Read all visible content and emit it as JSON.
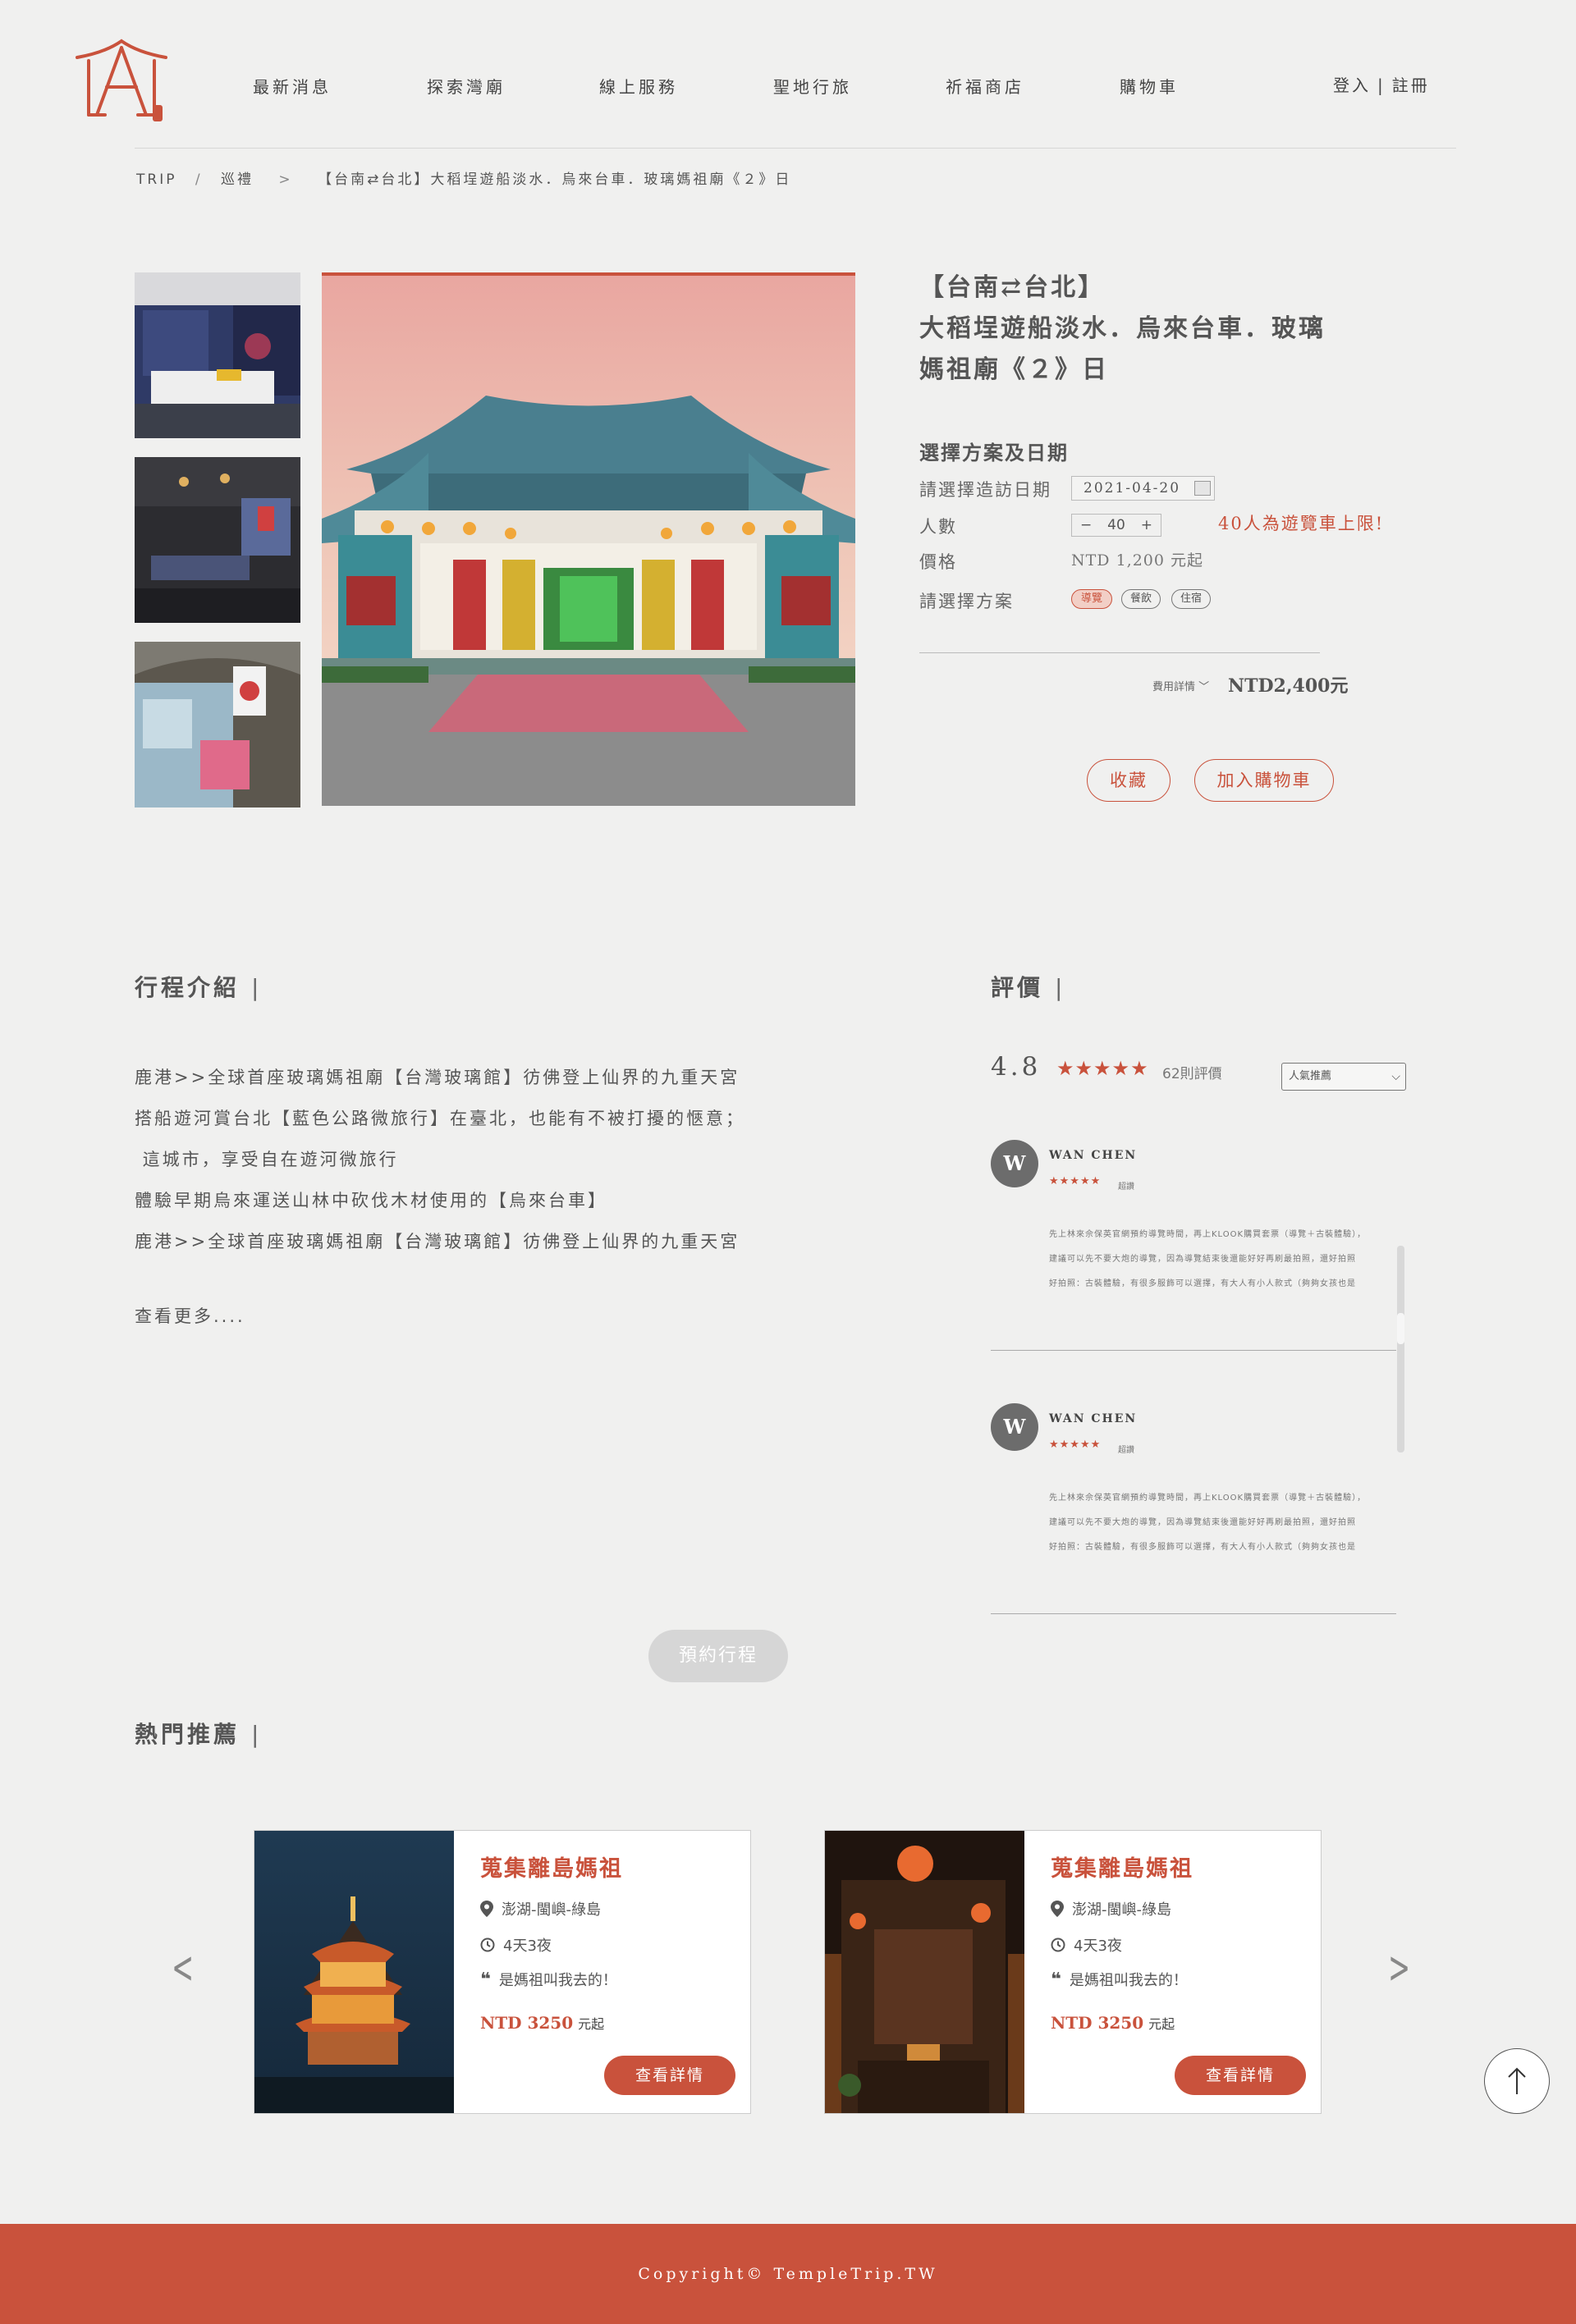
{
  "header": {
    "nav": [
      "最新消息",
      "探索灣廟",
      "線上服務",
      "聖地行旅",
      "祈福商店",
      "購物車"
    ],
    "login": "登入",
    "auth_sep": "|",
    "register": "註冊"
  },
  "breadcrumb": {
    "root": "TRIP",
    "sep": "/",
    "section": "巡禮",
    "arrow": ">",
    "current": "【台南⇄台北】大稻埕遊船淡水．烏來台車．玻璃媽祖廟《２》日"
  },
  "product": {
    "title_line1": "【台南⇄台北】",
    "title_line2": "大稻埕遊船淡水．烏來台車．玻璃",
    "title_line3": "媽祖廟《２》日",
    "options_heading": "選擇方案及日期",
    "date_label": "請選擇造訪日期",
    "date_value": "2021-04-20",
    "people_label": "人數",
    "people_minus": "−",
    "people_value": "40",
    "people_plus": "+",
    "limit_note": "40人為遊覽車上限!",
    "price_label": "價格",
    "price_value": "NTD 1,200 元起",
    "plan_label": "請選擇方案",
    "plans": [
      "導覽",
      "餐飲",
      "住宿"
    ],
    "fee_detail": "費用詳情 ﹀",
    "total": "NTD2,400元",
    "fav_button": "收藏",
    "cart_button": "加入購物車"
  },
  "itinerary": {
    "title": "行程介紹",
    "bar": "|",
    "lines": [
      "鹿港>>全球首座玻璃媽祖廟【台灣玻璃館】彷佛登上仙界的九重天宮",
      "搭船遊河賞台北【藍色公路微旅行】在臺北，也能有不被打擾的愜意；",
      " 這城市，享受自在遊河微旅行",
      "體驗早期烏來運送山林中砍伐木材使用的【烏來台車】",
      "鹿港>>全球首座玻璃媽祖廟【台灣玻璃館】彷佛登上仙界的九重天宮"
    ],
    "more": "查看更多...."
  },
  "reviews": {
    "title": "評價",
    "bar": "|",
    "score": "4.8",
    "stars": "★★★★★",
    "count": "62則評價",
    "sort_value": "人氣推薦",
    "items": [
      {
        "initial": "W",
        "name": "WAN CHEN",
        "stars": "★★★★★",
        "tag": "超讚",
        "body": [
          "先上林來佘保英官網預約導覽時間，再上KLOOK購買套票（導覽＋古裝體驗），",
          "建議可以先不要大炮的導覽，因為導覽結束後還能好好再刷最拍照，還好拍照",
          "好拍照：古裝體驗，有很多服飾可以選擇，有大人有小人款式（夠夠女孩也是"
        ]
      },
      {
        "initial": "W",
        "name": "WAN CHEN",
        "stars": "★★★★★",
        "tag": "超讚",
        "body": [
          "先上林來佘保英官網預約導覽時間，再上KLOOK購買套票（導覽＋古裝體驗），",
          "建議可以先不要大炮的導覽，因為導覽結束後還能好好再刷最拍照，還好拍照",
          "好拍照：古裝體驗，有很多服飾可以選擇，有大人有小人款式（夠夠女孩也是"
        ]
      }
    ]
  },
  "book_button": "預約行程",
  "recommend": {
    "title": "熱門推薦",
    "bar": "|",
    "cards": [
      {
        "title": "蒐集離島媽祖",
        "location": "澎湖-閩嶼-綠島",
        "duration": "4天3夜",
        "quote": "是媽祖叫我去的！",
        "price": "NTD 3250",
        "unit": "元起",
        "button": "查看詳情"
      },
      {
        "title": "蒐集離島媽祖",
        "location": "澎湖-閩嶼-綠島",
        "duration": "4天3夜",
        "quote": "是媽祖叫我去的！",
        "price": "NTD 3250",
        "unit": "元起",
        "button": "查看詳情"
      }
    ]
  },
  "footer": {
    "copyright": "Copyright© TempleTrip.TW"
  },
  "colors": {
    "accent": "#c9523c",
    "background": "#f0f0ef",
    "text": "#555555"
  },
  "icons": [
    "logo-icon",
    "calendar-icon",
    "map-pin-icon",
    "clock-icon",
    "quote-icon",
    "chevron-left-icon",
    "chevron-right-icon",
    "arrow-up-icon"
  ]
}
